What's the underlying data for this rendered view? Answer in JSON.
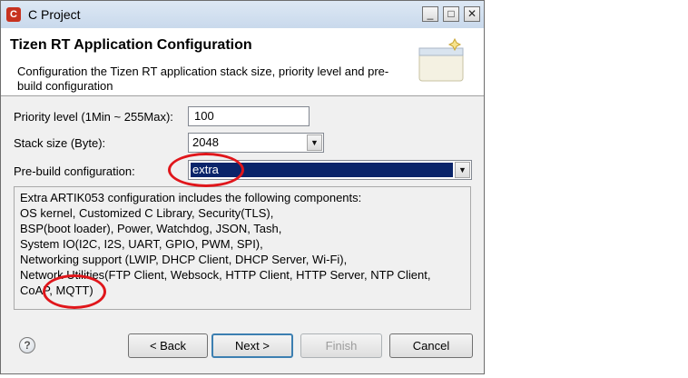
{
  "window": {
    "title": "C Project",
    "app_icon": "C"
  },
  "title_buttons": {
    "minimize": "_",
    "maximize": "□",
    "close": "✕"
  },
  "banner": {
    "title": "Tizen RT Application Configuration",
    "description": "Configuration the Tizen RT application stack size, priority level and pre-build configuration"
  },
  "form": {
    "priority_label": "Priority level (1Min ~ 255Max):",
    "priority_value": "100",
    "stack_label": "Stack size (Byte):",
    "stack_value": "2048",
    "prebuild_label": "Pre-build configuration:",
    "prebuild_value": "extra"
  },
  "description_lines": [
    "Extra ARTIK053 configuration includes the following components:",
    "OS kernel, Customized C Library, Security(TLS),",
    "BSP(boot loader), Power, Watchdog, JSON, Tash,",
    "System IO(I2C, I2S, UART, GPIO, PWM, SPI),",
    "Networking support (LWIP, DHCP Client, DHCP Server, Wi-Fi),",
    "Network Utilities(FTP Client, Websock, HTTP Client, HTTP Server, NTP Client,",
    "CoAP, MQTT)"
  ],
  "help": {
    "symbol": "?"
  },
  "buttons": {
    "back": "< Back",
    "next": "Next >",
    "finish": "Finish",
    "cancel": "Cancel"
  },
  "colors": {
    "annotation": "#e0161b",
    "selection": "#0a246a",
    "default_button": "#3c7fb1"
  }
}
